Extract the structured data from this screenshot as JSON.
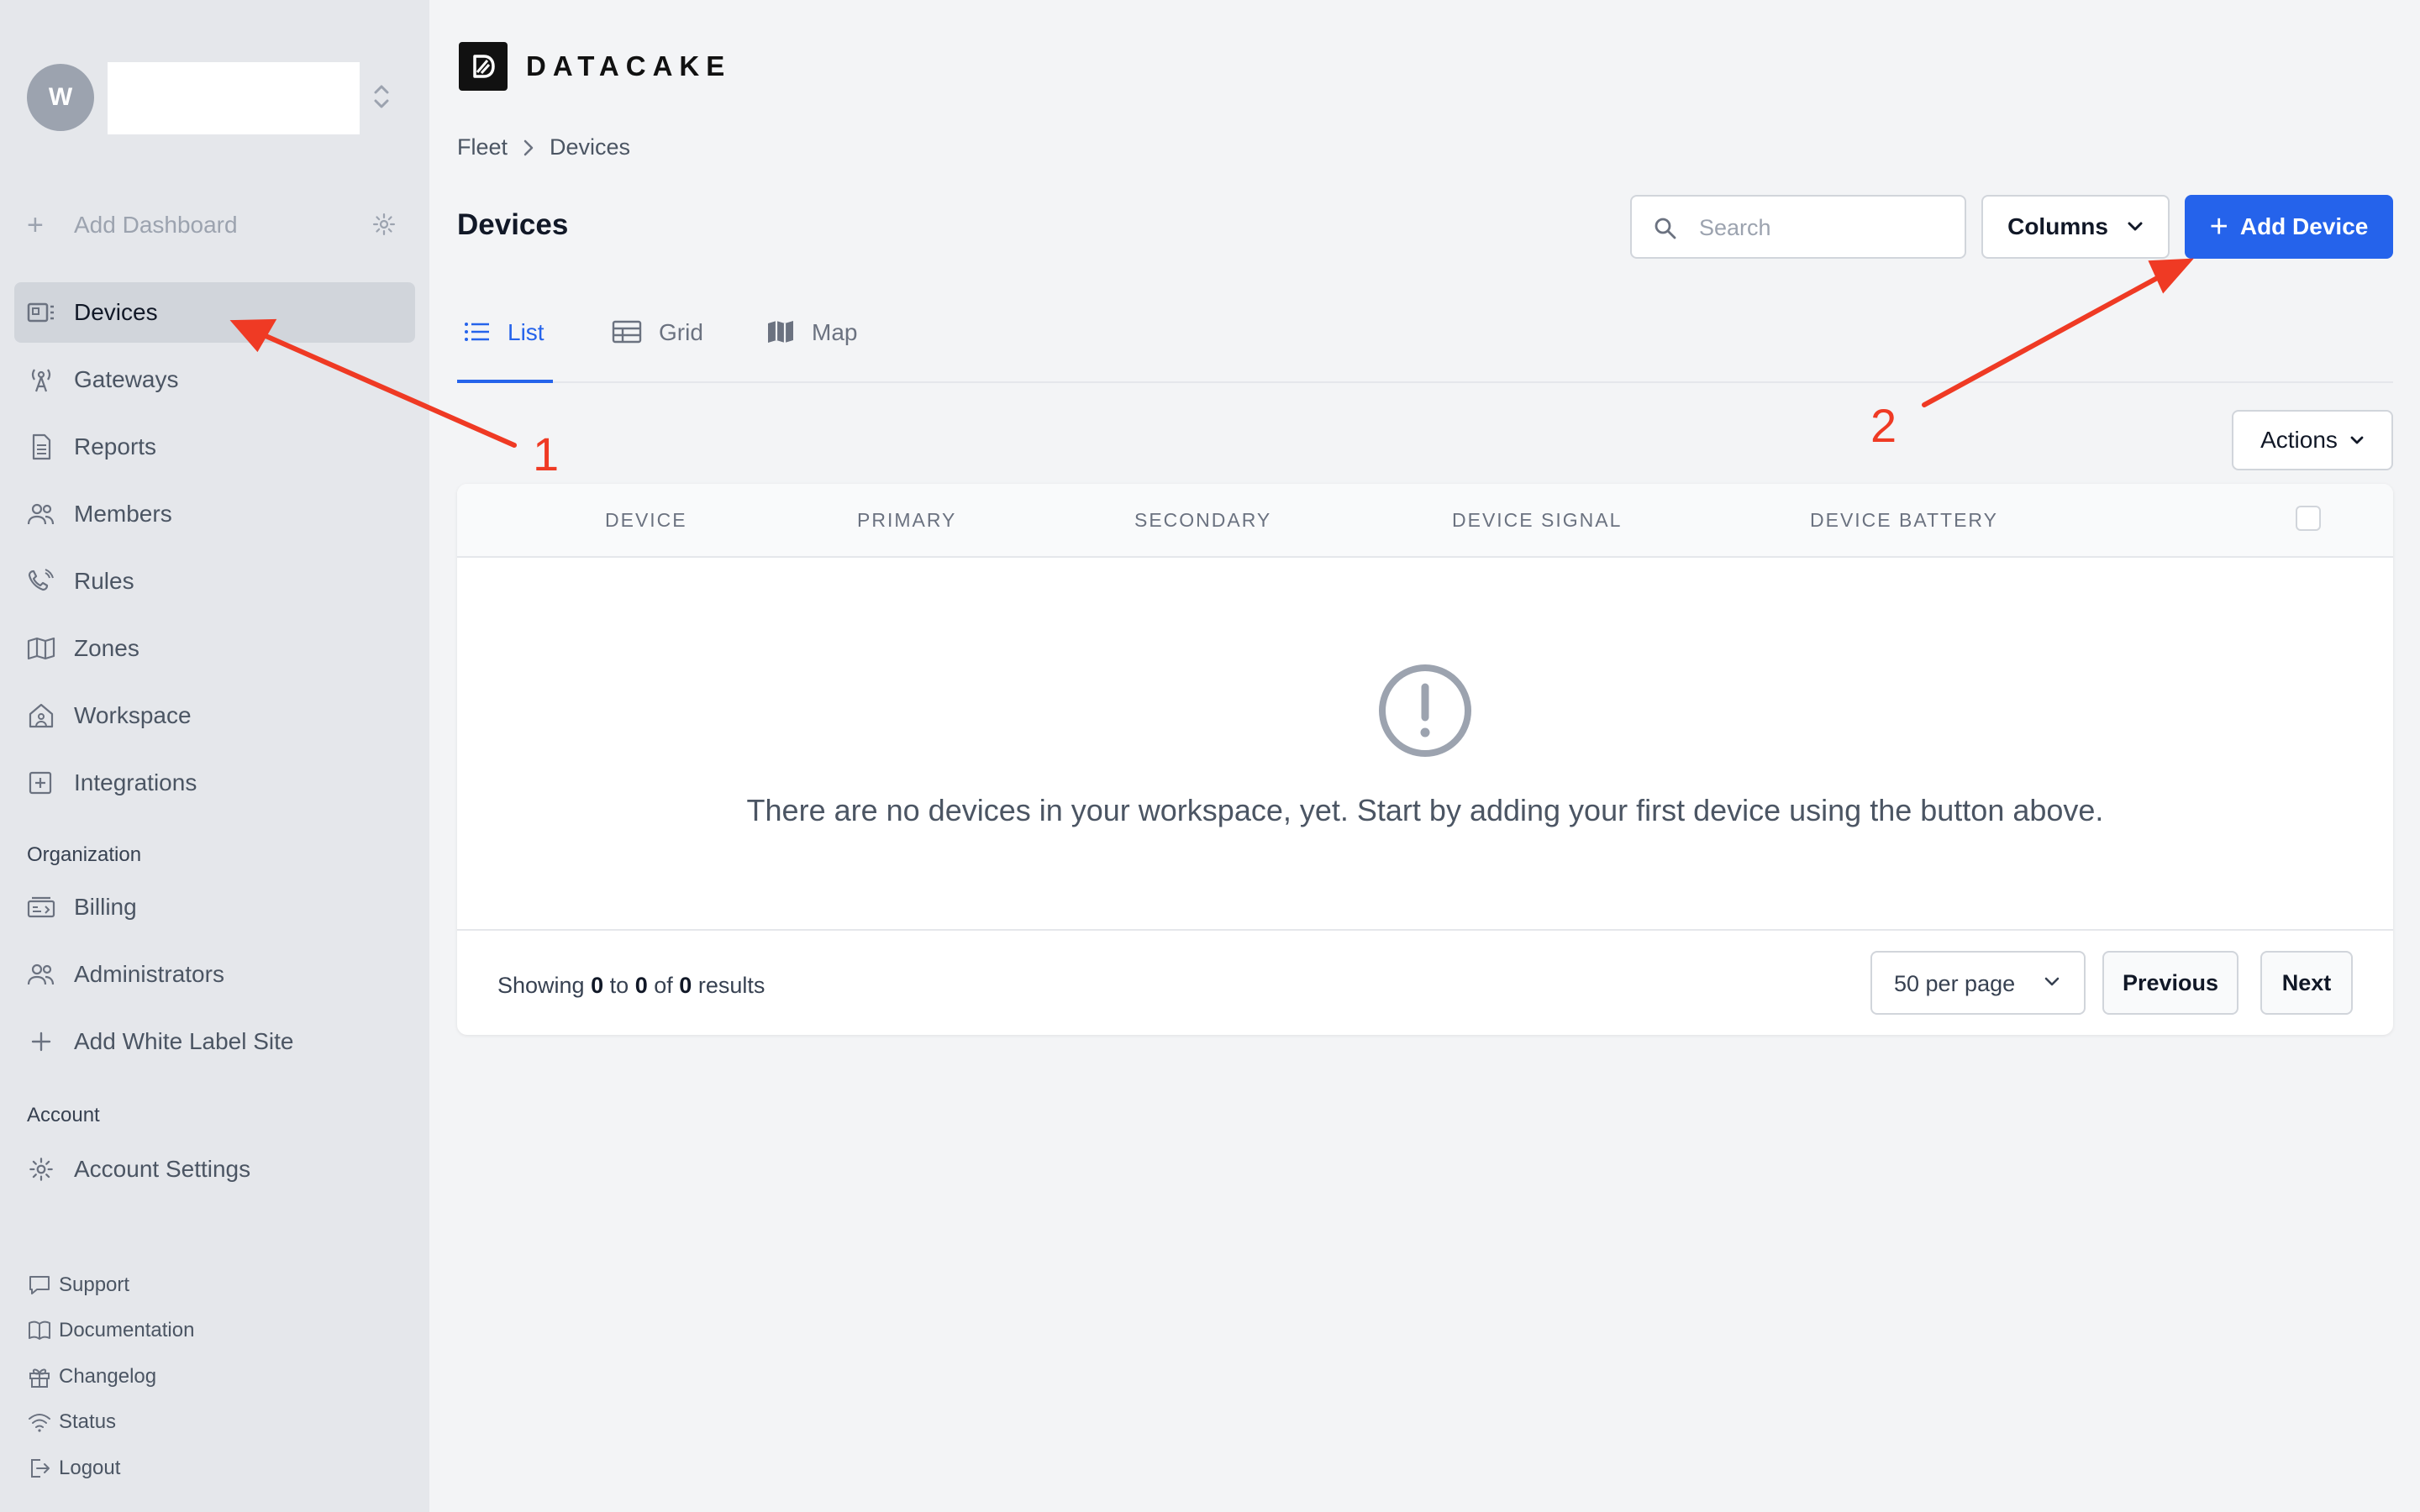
{
  "workspace": {
    "avatar_initial": "W"
  },
  "sidebar": {
    "add_dashboard": "Add Dashboard",
    "items": [
      {
        "label": "Devices",
        "icon": "devices-icon",
        "active": true
      },
      {
        "label": "Gateways",
        "icon": "gateway-icon"
      },
      {
        "label": "Reports",
        "icon": "report-icon"
      },
      {
        "label": "Members",
        "icon": "members-icon"
      },
      {
        "label": "Rules",
        "icon": "rules-icon"
      },
      {
        "label": "Zones",
        "icon": "map-icon"
      },
      {
        "label": "Workspace",
        "icon": "workspace-icon"
      },
      {
        "label": "Integrations",
        "icon": "integrations-icon"
      }
    ],
    "organization_heading": "Organization",
    "organization_items": [
      {
        "label": "Billing",
        "icon": "billing-icon"
      },
      {
        "label": "Administrators",
        "icon": "administrators-icon"
      },
      {
        "label": "Add White Label Site",
        "icon": "plus-icon"
      }
    ],
    "account_heading": "Account",
    "account_items": [
      {
        "label": "Account Settings",
        "icon": "gear-icon"
      }
    ],
    "footer_items": [
      {
        "label": "Support",
        "icon": "chat-icon"
      },
      {
        "label": "Documentation",
        "icon": "book-icon"
      },
      {
        "label": "Changelog",
        "icon": "gift-icon"
      },
      {
        "label": "Status",
        "icon": "wifi-icon"
      },
      {
        "label": "Logout",
        "icon": "logout-icon"
      }
    ]
  },
  "header": {
    "brand": "DATACAKE",
    "breadcrumb": [
      "Fleet",
      "Devices"
    ],
    "title": "Devices",
    "search_placeholder": "Search",
    "columns_label": "Columns",
    "add_device_label": "Add Device"
  },
  "tabs": [
    {
      "label": "List",
      "icon": "list-icon",
      "active": true
    },
    {
      "label": "Grid",
      "icon": "table-icon"
    },
    {
      "label": "Map",
      "icon": "map-icon"
    }
  ],
  "actions_label": "Actions",
  "table": {
    "columns": [
      "DEVICE",
      "PRIMARY",
      "SECONDARY",
      "DEVICE SIGNAL",
      "DEVICE BATTERY"
    ],
    "empty_message": "There are no devices in your workspace, yet. Start by adding your first device using the button above.",
    "showing_prefix": "Showing",
    "from": "0",
    "to_word": "to",
    "to": "0",
    "of_word": "of",
    "total": "0",
    "results_word": "results",
    "per_page": "50 per page",
    "previous": "Previous",
    "next": "Next"
  },
  "annotations": [
    "1",
    "2"
  ],
  "colors": {
    "accent": "#2563eb",
    "annotation": "#ef3a24",
    "sidebar_bg": "#e5e7eb"
  }
}
